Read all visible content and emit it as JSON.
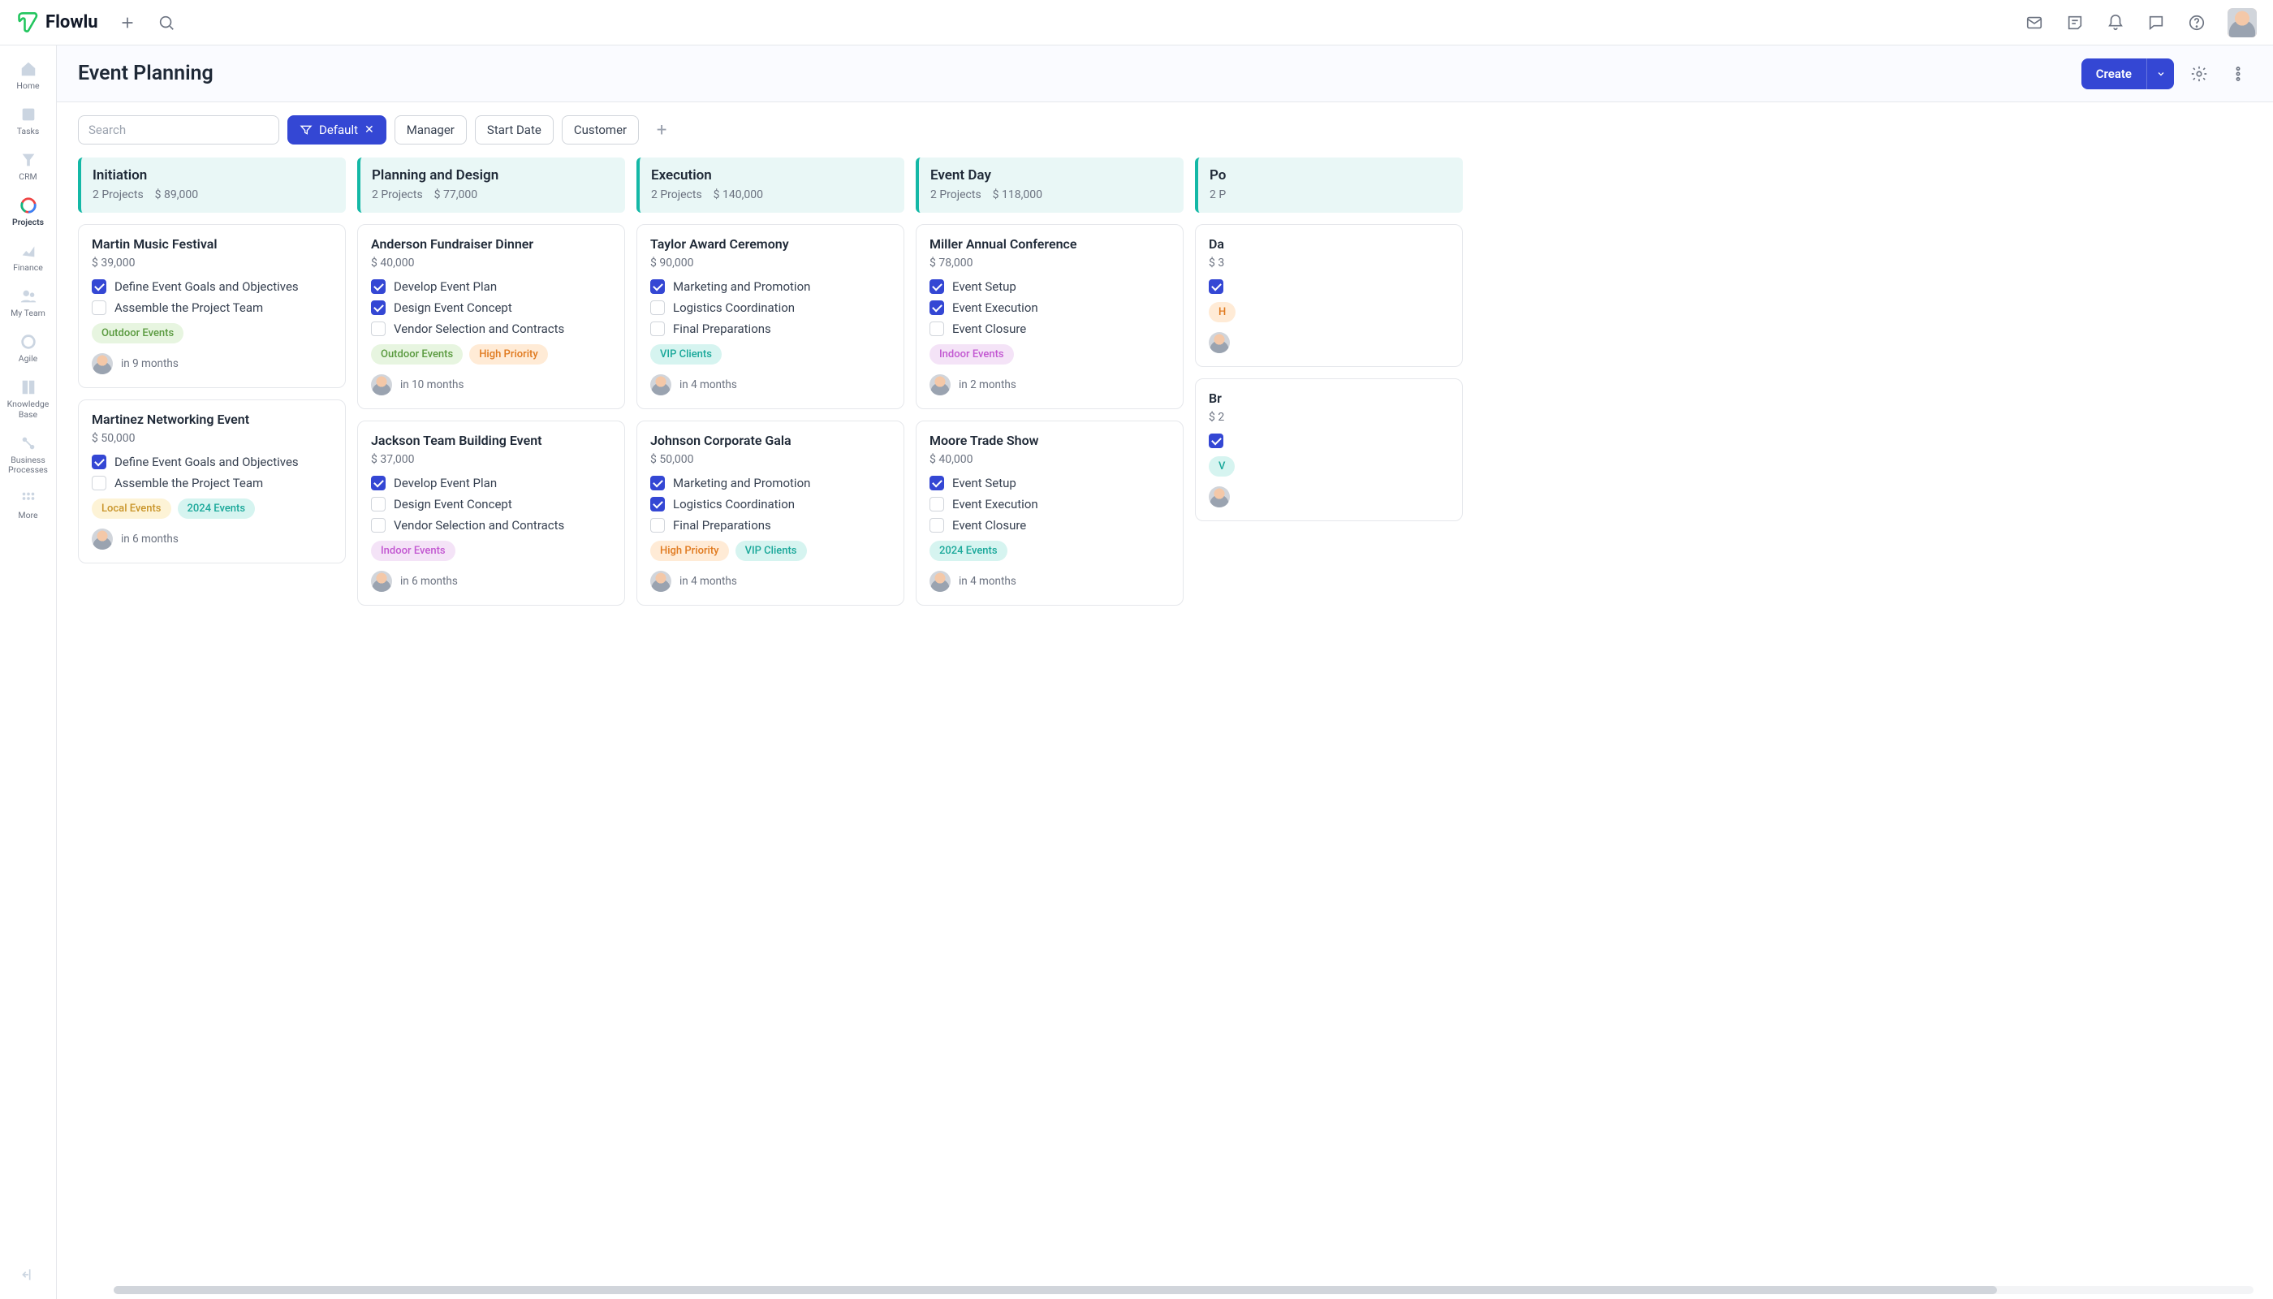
{
  "app": {
    "name": "Flowlu"
  },
  "topbar": {
    "plus_icon": "plus-icon",
    "search_icon": "search-icon",
    "icons": [
      "mail-icon",
      "notes-icon",
      "bell-icon",
      "chat-icon",
      "help-icon"
    ]
  },
  "sidebar": {
    "items": [
      {
        "id": "home",
        "label": "Home"
      },
      {
        "id": "tasks",
        "label": "Tasks"
      },
      {
        "id": "crm",
        "label": "CRM"
      },
      {
        "id": "projects",
        "label": "Projects",
        "active": true
      },
      {
        "id": "finance",
        "label": "Finance"
      },
      {
        "id": "myteam",
        "label": "My Team"
      },
      {
        "id": "agile",
        "label": "Agile"
      },
      {
        "id": "kb",
        "label": "Knowledge Base"
      },
      {
        "id": "bp",
        "label": "Business Processes"
      },
      {
        "id": "more",
        "label": "More"
      }
    ]
  },
  "page": {
    "title": "Event Planning",
    "create_label": "Create"
  },
  "filters": {
    "search_placeholder": "Search",
    "active": {
      "label": "Default"
    },
    "chips": [
      "Manager",
      "Start Date",
      "Customer"
    ]
  },
  "board": {
    "columns": [
      {
        "title": "Initiation",
        "sub_projects": "2 Projects",
        "sub_amount": "$ 89,000",
        "cards": [
          {
            "title": "Martin Music Festival",
            "amount": "$ 39,000",
            "tasks": [
              {
                "label": "Define Event Goals and Objectives",
                "checked": true
              },
              {
                "label": "Assemble the Project Team",
                "checked": false
              }
            ],
            "tags": [
              {
                "text": "Outdoor Events",
                "cls": "outdoor"
              }
            ],
            "due": "in 9 months"
          },
          {
            "title": "Martinez Networking Event",
            "amount": "$ 50,000",
            "tasks": [
              {
                "label": "Define Event Goals and Objectives",
                "checked": true
              },
              {
                "label": "Assemble the Project Team",
                "checked": false
              }
            ],
            "tags": [
              {
                "text": "Local Events",
                "cls": "local"
              },
              {
                "text": "2024 Events",
                "cls": "y2024"
              }
            ],
            "due": "in 6 months"
          }
        ]
      },
      {
        "title": "Planning and Design",
        "sub_projects": "2 Projects",
        "sub_amount": "$ 77,000",
        "cards": [
          {
            "title": "Anderson Fundraiser Dinner",
            "amount": "$ 40,000",
            "tasks": [
              {
                "label": "Develop Event Plan",
                "checked": true
              },
              {
                "label": "Design Event Concept",
                "checked": true
              },
              {
                "label": "Vendor Selection and Contracts",
                "checked": false
              }
            ],
            "tags": [
              {
                "text": "Outdoor Events",
                "cls": "outdoor"
              },
              {
                "text": "High Priority",
                "cls": "highprio"
              }
            ],
            "due": "in 10 months"
          },
          {
            "title": "Jackson Team Building Event",
            "amount": "$ 37,000",
            "tasks": [
              {
                "label": "Develop Event Plan",
                "checked": true
              },
              {
                "label": "Design Event Concept",
                "checked": false
              },
              {
                "label": "Vendor Selection and Contracts",
                "checked": false
              }
            ],
            "tags": [
              {
                "text": "Indoor Events",
                "cls": "indoor"
              }
            ],
            "due": "in 6 months"
          }
        ]
      },
      {
        "title": "Execution",
        "sub_projects": "2 Projects",
        "sub_amount": "$ 140,000",
        "cards": [
          {
            "title": "Taylor Award Ceremony",
            "amount": "$ 90,000",
            "tasks": [
              {
                "label": "Marketing and Promotion",
                "checked": true
              },
              {
                "label": "Logistics Coordination",
                "checked": false
              },
              {
                "label": "Final Preparations",
                "checked": false
              }
            ],
            "tags": [
              {
                "text": "VIP Clients",
                "cls": "vip"
              }
            ],
            "due": "in 4 months"
          },
          {
            "title": "Johnson Corporate Gala",
            "amount": "$ 50,000",
            "tasks": [
              {
                "label": "Marketing and Promotion",
                "checked": true
              },
              {
                "label": "Logistics Coordination",
                "checked": true
              },
              {
                "label": "Final Preparations",
                "checked": false
              }
            ],
            "tags": [
              {
                "text": "High Priority",
                "cls": "highprio"
              },
              {
                "text": "VIP Clients",
                "cls": "vip"
              }
            ],
            "due": "in 4 months"
          }
        ]
      },
      {
        "title": "Event Day",
        "sub_projects": "2 Projects",
        "sub_amount": "$ 118,000",
        "cards": [
          {
            "title": "Miller Annual Conference",
            "amount": "$ 78,000",
            "tasks": [
              {
                "label": "Event Setup",
                "checked": true
              },
              {
                "label": "Event Execution",
                "checked": true
              },
              {
                "label": "Event Closure",
                "checked": false
              }
            ],
            "tags": [
              {
                "text": "Indoor Events",
                "cls": "indoor"
              }
            ],
            "due": "in 2 months"
          },
          {
            "title": "Moore Trade Show",
            "amount": "$ 40,000",
            "tasks": [
              {
                "label": "Event Setup",
                "checked": true
              },
              {
                "label": "Event Execution",
                "checked": false
              },
              {
                "label": "Event Closure",
                "checked": false
              }
            ],
            "tags": [
              {
                "text": "2024 Events",
                "cls": "y2024"
              }
            ],
            "due": "in 4 months"
          }
        ]
      },
      {
        "title": "Po",
        "sub_projects": "2 P",
        "sub_amount": "",
        "cards": [
          {
            "title": "Da",
            "amount": "$ 3",
            "tasks": [
              {
                "label": "",
                "checked": true
              }
            ],
            "tags": [
              {
                "text": "H",
                "cls": "highprio"
              }
            ],
            "due": ""
          },
          {
            "title": "Br",
            "amount": "$ 2",
            "tasks": [
              {
                "label": "",
                "checked": true
              }
            ],
            "tags": [
              {
                "text": "V",
                "cls": "vip"
              }
            ],
            "due": ""
          }
        ]
      }
    ]
  }
}
